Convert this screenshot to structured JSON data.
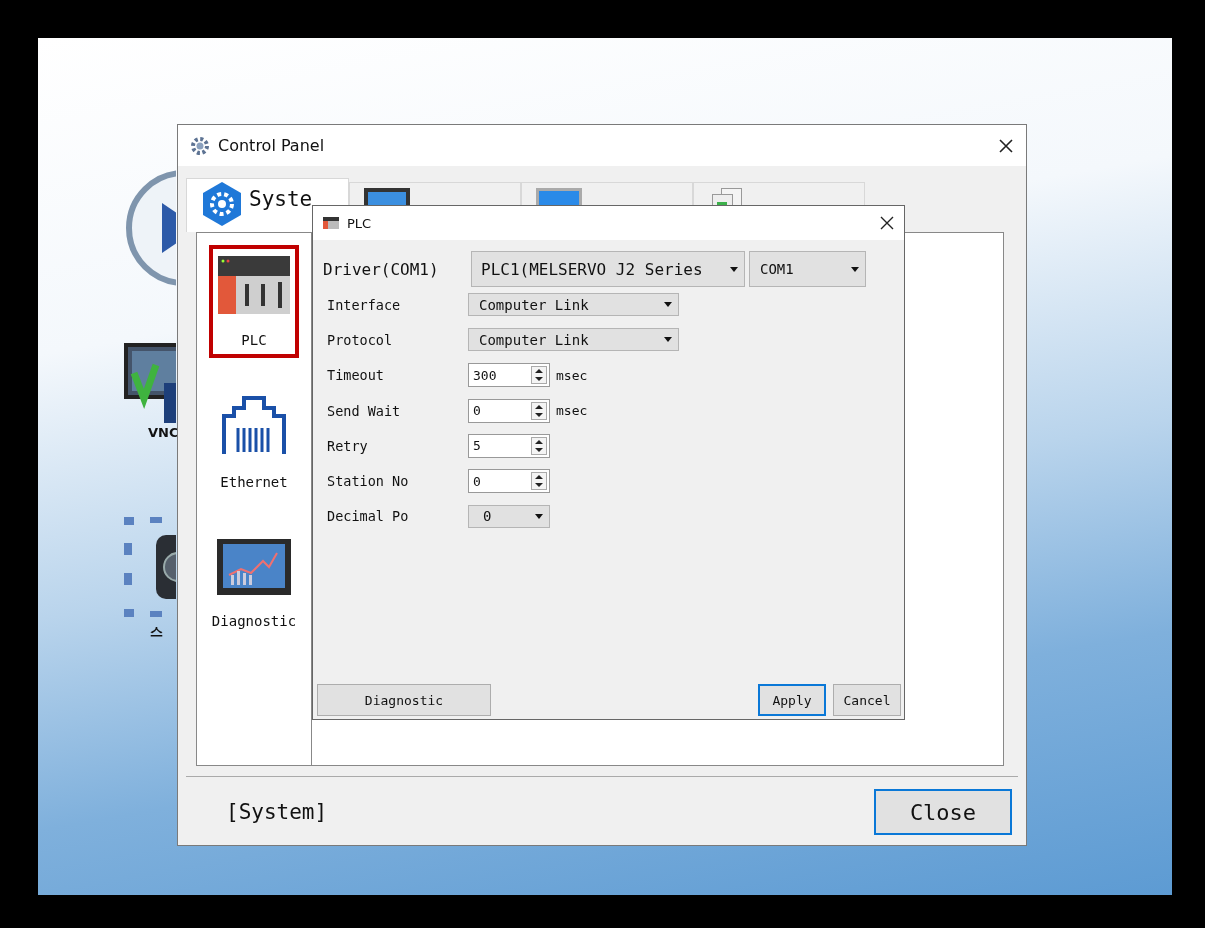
{
  "desktop": {
    "icons": [
      {
        "kind": "play"
      },
      {
        "kind": "vnc",
        "label": "VNC"
      },
      {
        "kind": "camera",
        "label": "스"
      }
    ]
  },
  "window": {
    "title": "Control Panel"
  },
  "tabs": [
    {
      "kind": "system",
      "label": "Syste",
      "selected": true
    },
    {
      "kind": "devices",
      "selected": false
    },
    {
      "kind": "service",
      "selected": false
    },
    {
      "kind": "option",
      "selected": false
    }
  ],
  "sidebar": {
    "items": [
      {
        "kind": "plc",
        "label": "PLC",
        "selected": true
      },
      {
        "kind": "ethernet",
        "label": "Ethernet",
        "selected": false
      },
      {
        "kind": "diagnostic",
        "label": "Diagnostic",
        "selected": false
      }
    ]
  },
  "dialog": {
    "title": "PLC",
    "driver": {
      "label": "Driver(COM1)",
      "value": "PLC1(MELSERVO J2 Series",
      "port": "COM1"
    },
    "fields": [
      {
        "kind": "dropdown",
        "label": "Interface",
        "value": "Computer Link"
      },
      {
        "kind": "dropdown",
        "label": "Protocol",
        "value": "Computer Link"
      },
      {
        "kind": "spin",
        "label": "Timeout",
        "value": "300",
        "unit": "msec"
      },
      {
        "kind": "spin",
        "label": "Send Wait",
        "value": "0",
        "unit": "msec"
      },
      {
        "kind": "spin",
        "label": "Retry",
        "value": "5"
      },
      {
        "kind": "spin",
        "label": "Station No",
        "value": "0"
      },
      {
        "kind": "small-dropdown",
        "label": "Decimal Po",
        "value": "0"
      }
    ],
    "diagnostic_button": "Diagnostic",
    "apply_button": "Apply",
    "cancel_button": "Cancel"
  },
  "status": "[System]",
  "close_button": "Close"
}
